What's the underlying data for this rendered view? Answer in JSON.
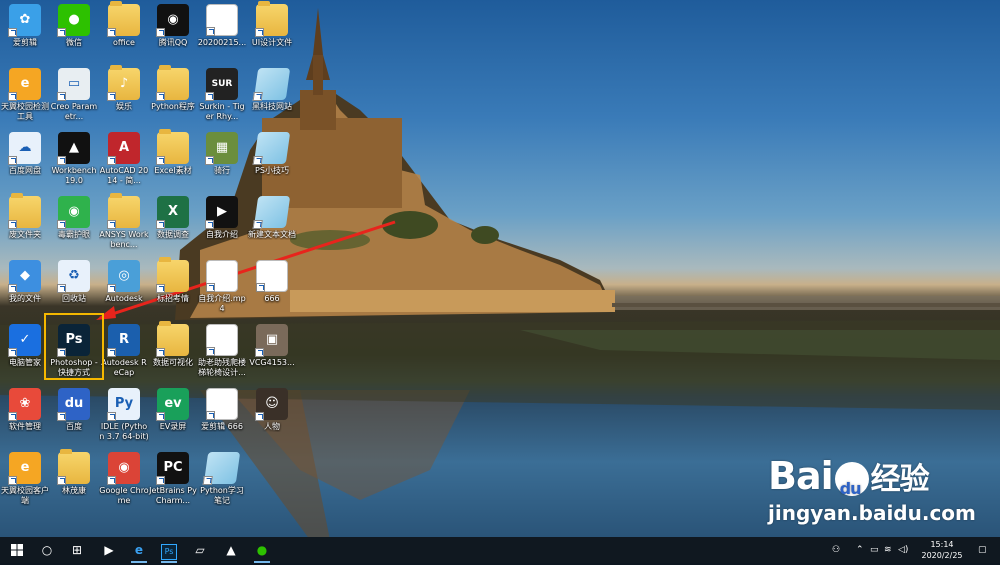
{
  "desktop": {
    "icons": [
      {
        "label": "爱剪辑",
        "glyph": "✿",
        "color": "#3aa0e8"
      },
      {
        "label": "微信",
        "glyph": "●",
        "color": "#2dc100"
      },
      {
        "label": "office",
        "glyph": "",
        "color": "folder"
      },
      {
        "label": "腾讯QQ",
        "glyph": "◉",
        "color": "#111111"
      },
      {
        "label": "20200215...",
        "glyph": "嗨",
        "color": "doc"
      },
      {
        "label": "UI设计文件",
        "glyph": "",
        "color": "folder"
      },
      {
        "label": "天翼校园检测工具",
        "glyph": "e",
        "color": "#f5a623"
      },
      {
        "label": "Creo Parametr...",
        "glyph": "▭",
        "color": "#e8eef2"
      },
      {
        "label": "娱乐",
        "glyph": "♪",
        "color": "folder"
      },
      {
        "label": "Python程序",
        "glyph": "",
        "color": "folder"
      },
      {
        "label": "Surkin - Tiger Rhy...",
        "glyph": "SUR",
        "color": "#222222"
      },
      {
        "label": "黑科技网站",
        "glyph": "",
        "color": "stack"
      },
      {
        "label": "百度网盘",
        "glyph": "☁",
        "color": "#e8f1fb"
      },
      {
        "label": "Workbench 19.0",
        "glyph": "▲",
        "color": "#111111"
      },
      {
        "label": "AutoCAD 2014 - 简...",
        "glyph": "A",
        "color": "#c0262c"
      },
      {
        "label": "Excel素材",
        "glyph": "",
        "color": "folder"
      },
      {
        "label": "骑行",
        "glyph": "▦",
        "color": "#6b8e3d"
      },
      {
        "label": "PS小技巧",
        "glyph": "",
        "color": "stack"
      },
      {
        "label": "废文件夹",
        "glyph": "",
        "color": "folder"
      },
      {
        "label": "毒霸护眼",
        "glyph": "◉",
        "color": "#2fb24c"
      },
      {
        "label": "ANSYS Workbenc...",
        "glyph": "",
        "color": "folder"
      },
      {
        "label": "数据调查",
        "glyph": "X",
        "color": "#1e7145"
      },
      {
        "label": "自我介绍",
        "glyph": "▶",
        "color": "#111111"
      },
      {
        "label": "新建文本文档",
        "glyph": "",
        "color": "stack"
      },
      {
        "label": "我的文件",
        "glyph": "◆",
        "color": "#3d8fe0"
      },
      {
        "label": "回收站",
        "glyph": "♻",
        "color": "#e8f1fb"
      },
      {
        "label": "Autodesk",
        "glyph": "◎",
        "color": "#4a9fd8"
      },
      {
        "label": "标招考情",
        "glyph": "",
        "color": "folder"
      },
      {
        "label": "自我介绍.mp4",
        "glyph": "▤",
        "color": "doc"
      },
      {
        "label": "666",
        "glyph": "▦",
        "color": "doc"
      },
      {
        "label": "电脑管家",
        "glyph": "✓",
        "color": "#1a6fe0"
      },
      {
        "label": "Photoshop - 快捷方式",
        "glyph": "Ps",
        "color": "#0a2438"
      },
      {
        "label": "Autodesk ReCap",
        "glyph": "R",
        "color": "#1b5fad"
      },
      {
        "label": "数据可视化",
        "glyph": "",
        "color": "folder"
      },
      {
        "label": "助老助残爬楼梯轮椅设计...",
        "glyph": "W",
        "color": "doc"
      },
      {
        "label": "VCG4153...",
        "glyph": "▣",
        "color": "#7a6a5a"
      },
      {
        "label": "软件管理",
        "glyph": "❀",
        "color": "#e84a3a"
      },
      {
        "label": "百度",
        "glyph": "du",
        "color": "#2e63c6"
      },
      {
        "label": "IDLE (Python 3.7 64-bit)",
        "glyph": "Py",
        "color": "#e8f1fb"
      },
      {
        "label": "EV录屏",
        "glyph": "ev",
        "color": "#19a05a"
      },
      {
        "label": "爱剪辑 666",
        "glyph": "嗨",
        "color": "doc"
      },
      {
        "label": "人物",
        "glyph": "☺",
        "color": "#3a3028"
      },
      {
        "label": "天翼校园客户端",
        "glyph": "e",
        "color": "#f5a623"
      },
      {
        "label": "林茂康",
        "glyph": "",
        "color": "folder"
      },
      {
        "label": "Google Chrome",
        "glyph": "◉",
        "color": "#db4437"
      },
      {
        "label": "JetBrains PyCharm...",
        "glyph": "PC",
        "color": "#111111"
      },
      {
        "label": "Python学习笔记",
        "glyph": "",
        "color": "stack"
      }
    ]
  },
  "watermark": {
    "brand_left": "Bai",
    "brand_right": "经验",
    "url": "jingyan.baidu.com"
  },
  "taskbar": {
    "start_icon": "windows-logo",
    "search_icon": "○",
    "task_view_icon": "⊞",
    "pinned": [
      {
        "name": "media-app",
        "glyph": "▶"
      },
      {
        "name": "edge",
        "glyph": "e"
      },
      {
        "name": "photoshop",
        "glyph": "Ps"
      },
      {
        "name": "notepad",
        "glyph": "▱"
      },
      {
        "name": "photos",
        "glyph": "▲"
      },
      {
        "name": "wechat",
        "glyph": "●"
      }
    ],
    "tray": {
      "people_icon": "⚇",
      "arrow": "⌃",
      "time": "15:14",
      "date": "2020/2/25"
    }
  },
  "colors": {
    "taskbar_bg": "#101820",
    "highlight": "#f5b800",
    "arrow": "#e8241c"
  }
}
